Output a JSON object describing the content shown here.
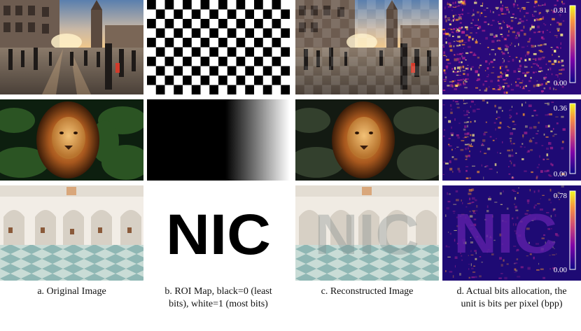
{
  "captions": {
    "a": "a. Original Image",
    "b_line1": "b. ROI Map, black=0 (least",
    "b_line2": "bits), white=1 (most bits)",
    "c": "c. Reconstructed Image",
    "d_line1": "d. Actual bits allocation, the",
    "d_line2": "unit is bits per pixel (bpp)"
  },
  "roi_text": "NIC",
  "colorbars": {
    "row1": {
      "max": "0.81",
      "min": "0.00"
    },
    "row2": {
      "max": "0.36",
      "min": "0.00"
    },
    "row3": {
      "max": "0.78",
      "min": "0.00"
    }
  },
  "colors": {
    "heat_bg": "#1e0a74",
    "heat_mid": "#b0258f",
    "heat_hot": "#ff9b2e",
    "heat_peak": "#fff28a"
  }
}
